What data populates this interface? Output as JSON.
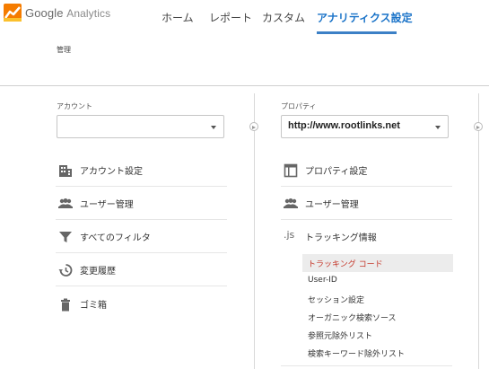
{
  "brand": {
    "google": "Google",
    "analytics": "Analytics"
  },
  "nav": {
    "home": "ホーム",
    "reports": "レポート",
    "custom": "カスタム",
    "admin": "アナリティクス設定"
  },
  "page_title": "管理",
  "account": {
    "label": "アカウント",
    "selected": "",
    "items": [
      {
        "label": "アカウント設定",
        "icon": "building-icon"
      },
      {
        "label": "ユーザー管理",
        "icon": "users-icon"
      },
      {
        "label": "すべてのフィルタ",
        "icon": "filter-icon"
      },
      {
        "label": "変更履歴",
        "icon": "history-icon"
      },
      {
        "label": "ゴミ箱",
        "icon": "trash-icon"
      }
    ]
  },
  "property": {
    "label": "プロパティ",
    "selected": "http://www.rootlinks.net",
    "items": [
      {
        "label": "プロパティ設定",
        "icon": "window-icon"
      },
      {
        "label": "ユーザー管理",
        "icon": "users-icon"
      },
      {
        "label": "トラッキング情報",
        "icon": "js-icon",
        "icon_text": ".js"
      }
    ],
    "tracking_sub": [
      "トラッキング コード",
      "User-ID",
      "セッション設定",
      "オーガニック検索ソース",
      "参照元除外リスト",
      "検索キーワード除外リスト"
    ]
  },
  "colors": {
    "accent": "#1a73c8",
    "active_sub": "#c5382b"
  }
}
